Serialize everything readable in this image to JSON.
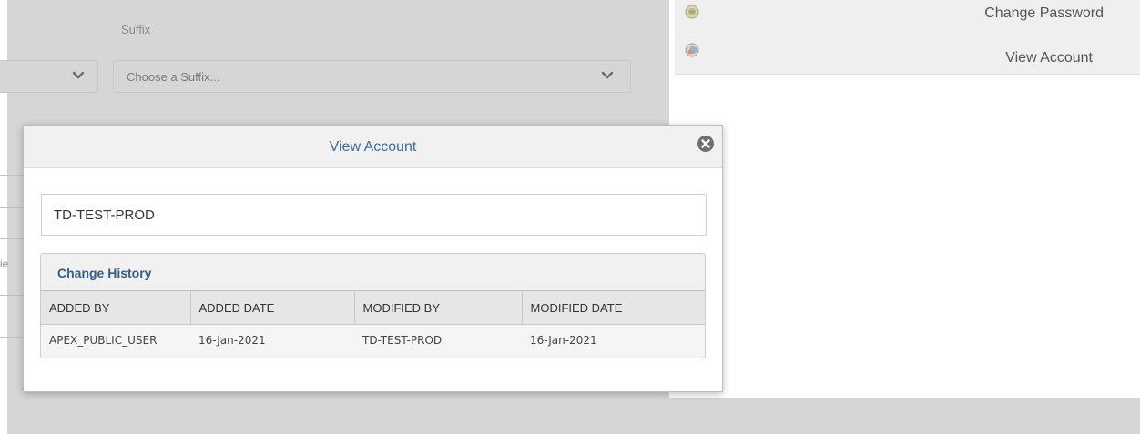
{
  "background_form": {
    "suffix_label": "Suffix",
    "suffix_placeholder": "Choose a Suffix...",
    "partial_link_text": "ie"
  },
  "right_menu": {
    "items": [
      {
        "label": "Change Password",
        "icon": "change-password-icon"
      },
      {
        "label": "View Account",
        "icon": "view-account-icon"
      }
    ]
  },
  "modal": {
    "title": "View Account",
    "account_value": "TD-TEST-PROD",
    "history": {
      "title": "Change History",
      "columns": [
        "ADDED BY",
        "ADDED DATE",
        "MODIFIED BY",
        "MODIFIED DATE"
      ],
      "rows": [
        [
          "APEX_PUBLIC_USER",
          "16-Jan-2021",
          "TD-TEST-PROD",
          "16-Jan-2021"
        ]
      ]
    }
  },
  "colors": {
    "accent": "#3a6e9a",
    "overlay_gray": "#d6d6d6"
  }
}
